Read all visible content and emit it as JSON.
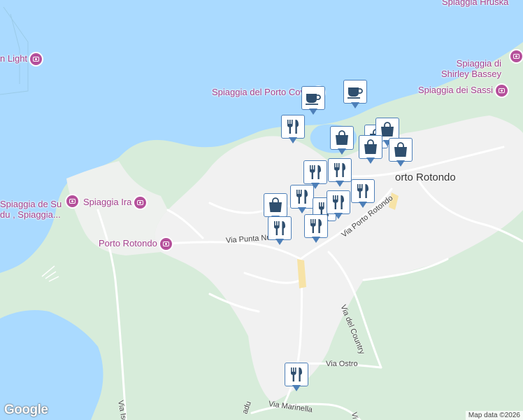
{
  "map": {
    "attribution": "Map data ©2026",
    "provider_logo": "Google",
    "colors": {
      "water": "#aadaff",
      "land": "#f2f2f2",
      "vegetation": "#d7ecda",
      "poi": "#a3408c",
      "marker_border": "#4d7fb8",
      "marker_icon": "#2f4f6f"
    },
    "places": [
      {
        "name": "Spiaggia Hruska",
        "icon": "camera-icon"
      },
      {
        "name": "n Light",
        "icon": "camera-icon"
      },
      {
        "name": "Spiaggia di\nShirley Bassey",
        "icon": "camera-icon"
      },
      {
        "name": "Spiaggia del Porto Cove",
        "icon": "camera-icon"
      },
      {
        "name": "Spiaggia dei Sassi",
        "icon": "camera-icon"
      },
      {
        "name": "Spiaggia de Su\ndu , Spiaggia...",
        "icon": "camera-icon"
      },
      {
        "name": "Spiaggia Ira",
        "icon": "camera-icon"
      },
      {
        "name": "Porto Rotondo",
        "icon": "camera-icon"
      }
    ],
    "locality": "orto Rotondo",
    "streets": [
      "Via Punta Nuragh",
      "Via Porto Rotondo",
      "Via del Country",
      "Via Ostro",
      "Via Marinella",
      "Via Isc",
      "adu",
      "Vi"
    ],
    "markers": [
      {
        "type": "cafe",
        "icon": "coffee-cup-icon"
      },
      {
        "type": "cafe",
        "icon": "coffee-cup-icon"
      },
      {
        "type": "restaurant",
        "icon": "fork-knife-icon"
      },
      {
        "type": "shop",
        "icon": "shopping-bag-icon"
      },
      {
        "type": "shop",
        "icon": "shopping-bag-icon"
      },
      {
        "type": "shop",
        "icon": "shopping-bag-icon"
      },
      {
        "type": "shop",
        "icon": "shopping-bag-icon"
      },
      {
        "type": "shop",
        "icon": "shopping-bag-icon"
      },
      {
        "type": "restaurant",
        "icon": "fork-knife-icon"
      },
      {
        "type": "restaurant",
        "icon": "fork-knife-icon"
      },
      {
        "type": "restaurant",
        "icon": "fork-knife-icon"
      },
      {
        "type": "restaurant",
        "icon": "fork-knife-icon"
      },
      {
        "type": "shop",
        "icon": "shopping-bag-icon"
      },
      {
        "type": "restaurant",
        "icon": "fork-knife-icon"
      },
      {
        "type": "restaurant",
        "icon": "fork-knife-icon"
      },
      {
        "type": "restaurant",
        "icon": "fork-knife-icon"
      },
      {
        "type": "restaurant",
        "icon": "fork-knife-icon"
      },
      {
        "type": "restaurant",
        "icon": "fork-knife-icon"
      }
    ]
  }
}
